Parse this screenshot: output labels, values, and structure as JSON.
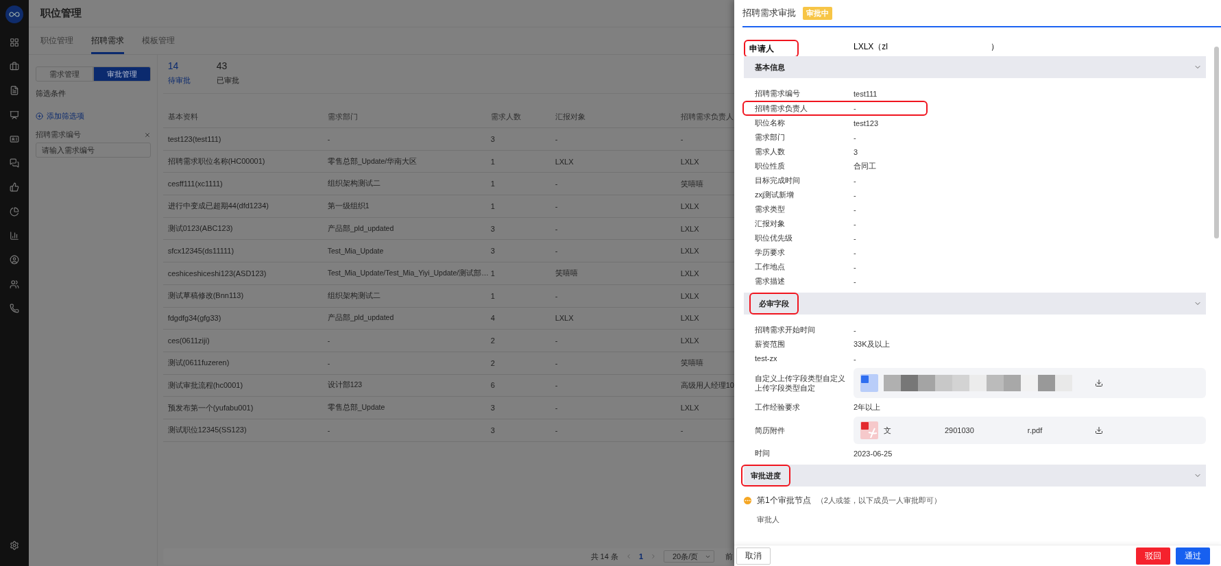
{
  "page": {
    "title": "职位管理",
    "tabs": [
      {
        "label": "职位管理",
        "selected": false
      },
      {
        "label": "招聘需求",
        "selected": true
      },
      {
        "label": "模板管理",
        "selected": false
      }
    ],
    "segments": [
      {
        "label": "需求管理",
        "selected": false
      },
      {
        "label": "审批管理",
        "selected": true
      }
    ],
    "filter": {
      "title": "筛选条件",
      "add_label": "添加筛选项",
      "fields": [
        {
          "label": "招聘需求编号",
          "placeholder": "请输入需求编号"
        }
      ]
    },
    "stats": [
      {
        "value": "14",
        "label": "待审批",
        "selected": true
      },
      {
        "value": "43",
        "label": "已审批",
        "selected": false
      }
    ],
    "table": {
      "columns": [
        "基本资料",
        "需求部门",
        "需求人数",
        "汇报对象",
        "招聘需求负责人"
      ],
      "rows": [
        [
          "test123(test111)",
          "-",
          "3",
          "-",
          "-"
        ],
        [
          "招聘需求职位名称(HC00001)",
          "零售总部_Update/华南大区",
          "1",
          "LXLX",
          "LXLX"
        ],
        [
          "cesff111(xc1111)",
          "组织架构测试二",
          "1",
          "-",
          "笑嘻嘻"
        ],
        [
          "进行中变成已超期44(dfd1234)",
          "第一级组织1",
          "1",
          "-",
          "LXLX"
        ],
        [
          "测试0123(ABC123)",
          "产品部_pld_updated",
          "3",
          "-",
          "LXLX"
        ],
        [
          "sfcx12345(ds11111)",
          "Test_Mia_Update",
          "3",
          "-",
          "LXLX"
        ],
        [
          "ceshiceshiceshi123(ASD123)",
          "Test_Mia_Update/Test_Mia_Yiyi_Update/测试部…",
          "1",
          "笑嘻嘻",
          "LXLX"
        ],
        [
          "测试草稿修改(Bnn113)",
          "组织架构测试二",
          "1",
          "-",
          "LXLX"
        ],
        [
          "fdgdfg34(gfg33)",
          "产品部_pld_updated",
          "4",
          "LXLX",
          "LXLX"
        ],
        [
          "ces(0611ziji)",
          "-",
          "2",
          "-",
          "LXLX"
        ],
        [
          "测试(0611fuzeren)",
          "-",
          "2",
          "-",
          "笑嘻嘻"
        ],
        [
          "测试审批流程(hc0001)",
          "设计部123",
          "6",
          "-",
          "高级用人经理10"
        ],
        [
          "预发布第一个(yufabu001)",
          "零售总部_Update",
          "3",
          "-",
          "LXLX"
        ],
        [
          "测试职位12345(SS123)",
          "-",
          "3",
          "-",
          "-"
        ]
      ]
    },
    "pagination": {
      "total": "共 14 条",
      "pages": [
        {
          "label": "1",
          "selected": true
        }
      ],
      "page_size": "20条/页",
      "jump_label": "前"
    }
  },
  "drawer": {
    "title": "招聘需求审批",
    "status": "审批中",
    "applicant": {
      "label": "申请人",
      "value": "LXLX（zl",
      "value_end": "）",
      "highlighted": true
    },
    "sections": [
      {
        "title": "基本信息",
        "highlighted": false,
        "expanded": true,
        "fields": [
          {
            "kind": "text",
            "label": "招聘需求编号",
            "value": "test111",
            "highlighted": false
          },
          {
            "kind": "text",
            "label": "招聘需求负责人",
            "value": "-",
            "highlighted": true
          },
          {
            "kind": "text",
            "label": "职位名称",
            "value": "test123",
            "highlighted": false
          },
          {
            "kind": "text",
            "label": "需求部门",
            "value": "-",
            "highlighted": false
          },
          {
            "kind": "text",
            "label": "需求人数",
            "value": "3",
            "highlighted": false
          },
          {
            "kind": "text",
            "label": "职位性质",
            "value": "合同工",
            "highlighted": false
          },
          {
            "kind": "text",
            "label": "目标完成时间",
            "value": "-",
            "highlighted": false
          },
          {
            "kind": "text",
            "label": "zxj测试新增",
            "value": "-",
            "highlighted": false
          },
          {
            "kind": "text",
            "label": "需求类型",
            "value": "-",
            "highlighted": false
          },
          {
            "kind": "text",
            "label": "汇报对象",
            "value": "-",
            "highlighted": false
          },
          {
            "kind": "text",
            "label": "职位优先级",
            "value": "-",
            "highlighted": false
          },
          {
            "kind": "text",
            "label": "学历要求",
            "value": "-",
            "highlighted": false
          },
          {
            "kind": "text",
            "label": "工作地点",
            "value": "-",
            "highlighted": false
          },
          {
            "kind": "text",
            "label": "需求描述",
            "value": "-",
            "highlighted": false
          }
        ]
      },
      {
        "title": "必审字段",
        "highlighted": true,
        "expanded": true,
        "fields": [
          {
            "kind": "text",
            "label": "招聘需求开始时间",
            "value": "-",
            "highlighted": false
          },
          {
            "kind": "text",
            "label": "薪资范围",
            "value": "33K及以上",
            "highlighted": false
          },
          {
            "kind": "text",
            "label": "test-zx",
            "value": "-",
            "highlighted": false
          },
          {
            "kind": "word_file",
            "label": "自定义上传字段类型自定义上传字段类型自定",
            "highlighted": false
          },
          {
            "kind": "text",
            "label": "工作经验要求",
            "value": "2年以上",
            "highlighted": false
          },
          {
            "kind": "pdf_file",
            "label": "简历附件",
            "name_parts": [
              "文",
              "2901030",
              "r.pdf"
            ],
            "highlighted": false
          },
          {
            "kind": "text",
            "label": "时间",
            "value": "2023-06-25",
            "highlighted": false
          }
        ]
      },
      {
        "title": "审批进度",
        "highlighted": true,
        "expanded": true,
        "nodes": [
          {
            "title": "第1个审批节点",
            "note": "（2人或签，以下成员一人审批即可）",
            "sub_label": "审批人"
          }
        ]
      }
    ],
    "buttons": [
      {
        "label": "取消",
        "kind": "default"
      },
      {
        "label": "驳回",
        "kind": "danger"
      },
      {
        "label": "通过",
        "kind": "primary"
      }
    ]
  }
}
